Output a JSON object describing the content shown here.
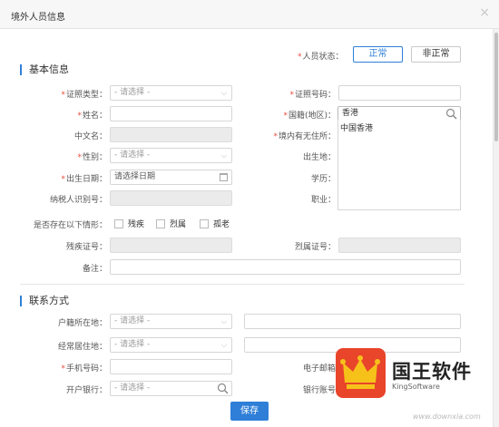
{
  "window": {
    "title": "境外人员信息",
    "close": "×"
  },
  "status": {
    "label": "人员状态：",
    "normal": "正常",
    "abnormal": "非正常"
  },
  "sections": {
    "basic": "基本信息",
    "contact": "联系方式"
  },
  "labels": {
    "id_type": "证照类型：",
    "id_number": "证照号码：",
    "name": "姓名：",
    "nationality": "国籍(地区)：",
    "chinese_name": "中文名：",
    "residence": "境内有无住所：",
    "gender": "性别：",
    "birthplace": "出生地：",
    "birthdate": "出生日期：",
    "education": "学历：",
    "taxpayer_id": "纳税人识别号：",
    "occupation": "职业：",
    "situation": "是否存在以下情形：",
    "disability_no": "残疾证号：",
    "martyr_no": "烈属证号：",
    "remark": "备注：",
    "household": "户籍所在地：",
    "habitual": "经常居住地：",
    "mobile": "手机号码：",
    "email": "电子邮箱",
    "bank": "开户银行：",
    "account": "银行账号"
  },
  "placeholders": {
    "select": "- 请选择 -",
    "date": "请选择日期"
  },
  "values": {
    "nationality": "香港"
  },
  "dropdown": {
    "items": [
      "中国香港"
    ]
  },
  "checkboxes": [
    "残疾",
    "烈属",
    "孤老"
  ],
  "save": "保存",
  "watermark": {
    "name": "国王软件",
    "sub": "KingSoftware",
    "url": "www.downxia.com"
  },
  "colors": {
    "accent": "#2f7fd8",
    "required": "#e84b3c",
    "logo": "#e8452b"
  }
}
